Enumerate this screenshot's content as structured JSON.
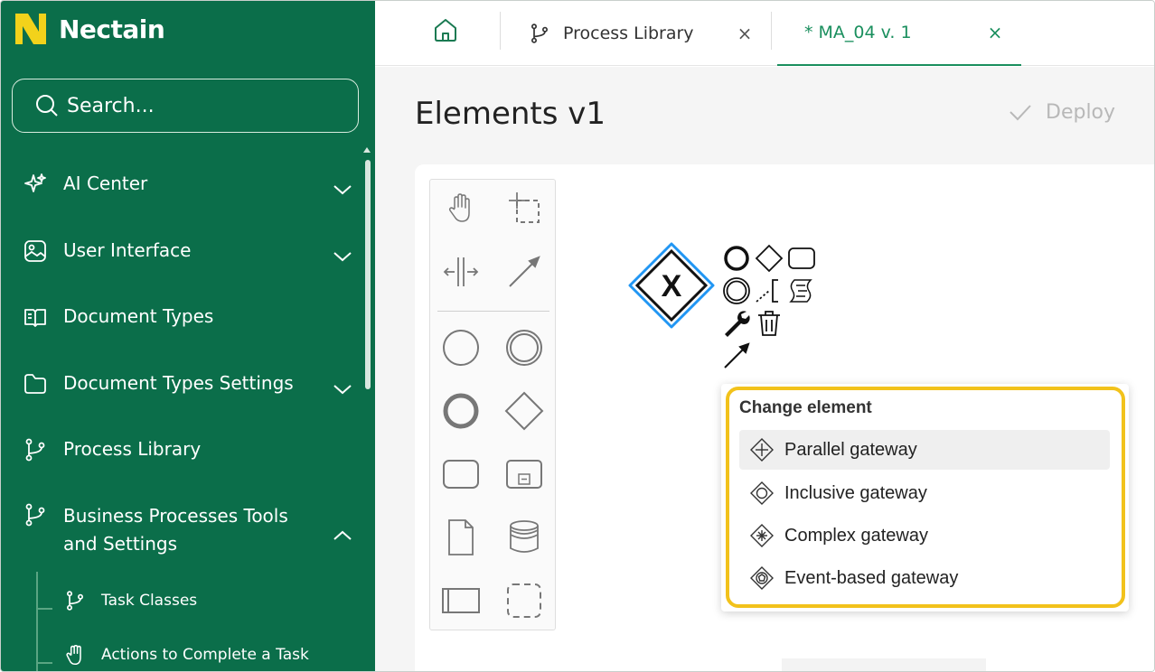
{
  "brand": {
    "name": "Nectain",
    "accent": "#0b6e4a",
    "logo_color": "#f2d21b"
  },
  "search": {
    "placeholder": "Search..."
  },
  "sidebar": {
    "items": [
      {
        "label": "AI Center",
        "icon": "sparkle-icon",
        "expandable": true,
        "expanded": false
      },
      {
        "label": "User Interface",
        "icon": "image-icon",
        "expandable": true,
        "expanded": false
      },
      {
        "label": "Document Types",
        "icon": "book-icon",
        "expandable": false
      },
      {
        "label": "Document Types Settings",
        "icon": "folder-icon",
        "expandable": true,
        "expanded": false
      },
      {
        "label": "Process Library",
        "icon": "git-branch-icon",
        "expandable": false
      },
      {
        "label": "Business Processes Tools",
        "label2": "and Settings",
        "icon": "git-branch-icon",
        "expandable": true,
        "expanded": true
      }
    ],
    "subitems": [
      {
        "label": "Task Classes",
        "icon": "git-branch-icon"
      },
      {
        "label": "Actions to Complete a Task",
        "icon": "hand-icon"
      }
    ]
  },
  "tabs": {
    "home_icon": "home-icon",
    "items": [
      {
        "label": "Process Library",
        "icon": "git-branch-icon",
        "active": false
      },
      {
        "label": "* MA_04 v. 1",
        "active": true
      }
    ],
    "close_glyph": "×"
  },
  "page": {
    "title": "Elements v1",
    "deploy_label": "Deploy"
  },
  "palette": {
    "tools": [
      "hand-tool",
      "lasso-tool",
      "space-tool",
      "connect-tool",
      "start-event",
      "intermediate-event",
      "end-event",
      "gateway",
      "task",
      "subprocess",
      "data-object",
      "data-store",
      "pool",
      "group"
    ]
  },
  "gateway": {
    "symbol": "X",
    "type": "exclusive-gateway"
  },
  "context_pad": [
    "end-event",
    "gateway",
    "task",
    "intermediate-event",
    "text-annotation",
    "script",
    "wrench",
    "delete",
    "connect"
  ],
  "popup": {
    "title": "Change element",
    "items": [
      {
        "label": "Parallel gateway",
        "icon": "parallel-gateway-icon",
        "hover": true
      },
      {
        "label": "Inclusive gateway",
        "icon": "inclusive-gateway-icon"
      },
      {
        "label": "Complex gateway",
        "icon": "complex-gateway-icon"
      },
      {
        "label": "Event-based gateway",
        "icon": "event-based-gateway-icon"
      }
    ]
  },
  "colors": {
    "selection": "#2196f3",
    "highlight": "#f2c21b"
  }
}
